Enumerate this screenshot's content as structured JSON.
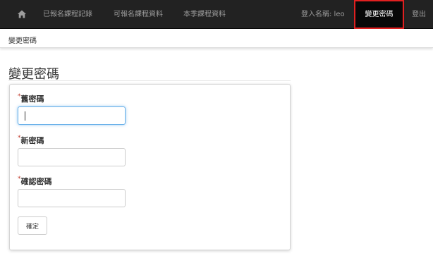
{
  "nav": {
    "home_icon": "home-icon",
    "links": [
      {
        "label": "已報名課程記錄"
      },
      {
        "label": "可報名課程資料"
      },
      {
        "label": "本季課程資料"
      }
    ],
    "user_label": "登入名稱: leo",
    "change_password": "變更密碼",
    "logout": "登出",
    "active_outline_color": "#e02020"
  },
  "breadcrumb": {
    "current": "變更密碼"
  },
  "page": {
    "title": "變更密碼"
  },
  "form": {
    "required_mark": "*",
    "fields": [
      {
        "label": "舊密碼",
        "value": ""
      },
      {
        "label": "新密碼",
        "value": ""
      },
      {
        "label": "確認密碼",
        "value": ""
      }
    ],
    "submit_label": "確定"
  }
}
